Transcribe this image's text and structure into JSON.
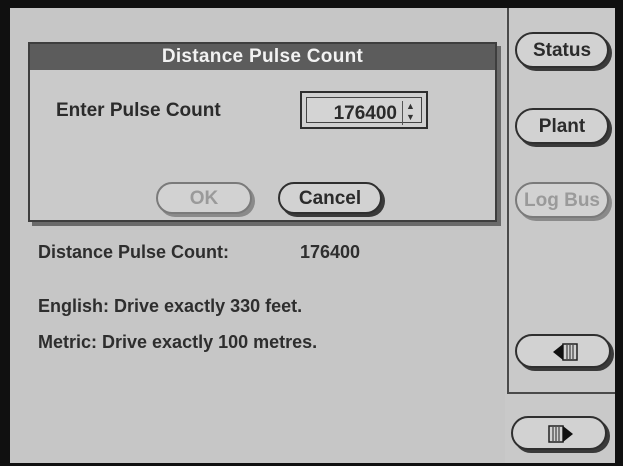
{
  "dialog": {
    "title": "Distance Pulse Count",
    "prompt_label": "Enter Pulse Count",
    "pulse_value": "176400",
    "ok_label": "OK",
    "cancel_label": "Cancel"
  },
  "info": {
    "pulse_count_label": "Distance Pulse Count:",
    "pulse_count_value": "176400",
    "english_line": "English: Drive exactly 330 feet.",
    "metric_line": "Metric: Drive exactly 100 metres."
  },
  "sidebar": {
    "status_label": "Status",
    "plant_label": "Plant",
    "log_bus_label": "Log Bus"
  },
  "nav": {
    "back_icon": "back-arrow-icon",
    "forward_icon": "forward-arrow-icon"
  }
}
